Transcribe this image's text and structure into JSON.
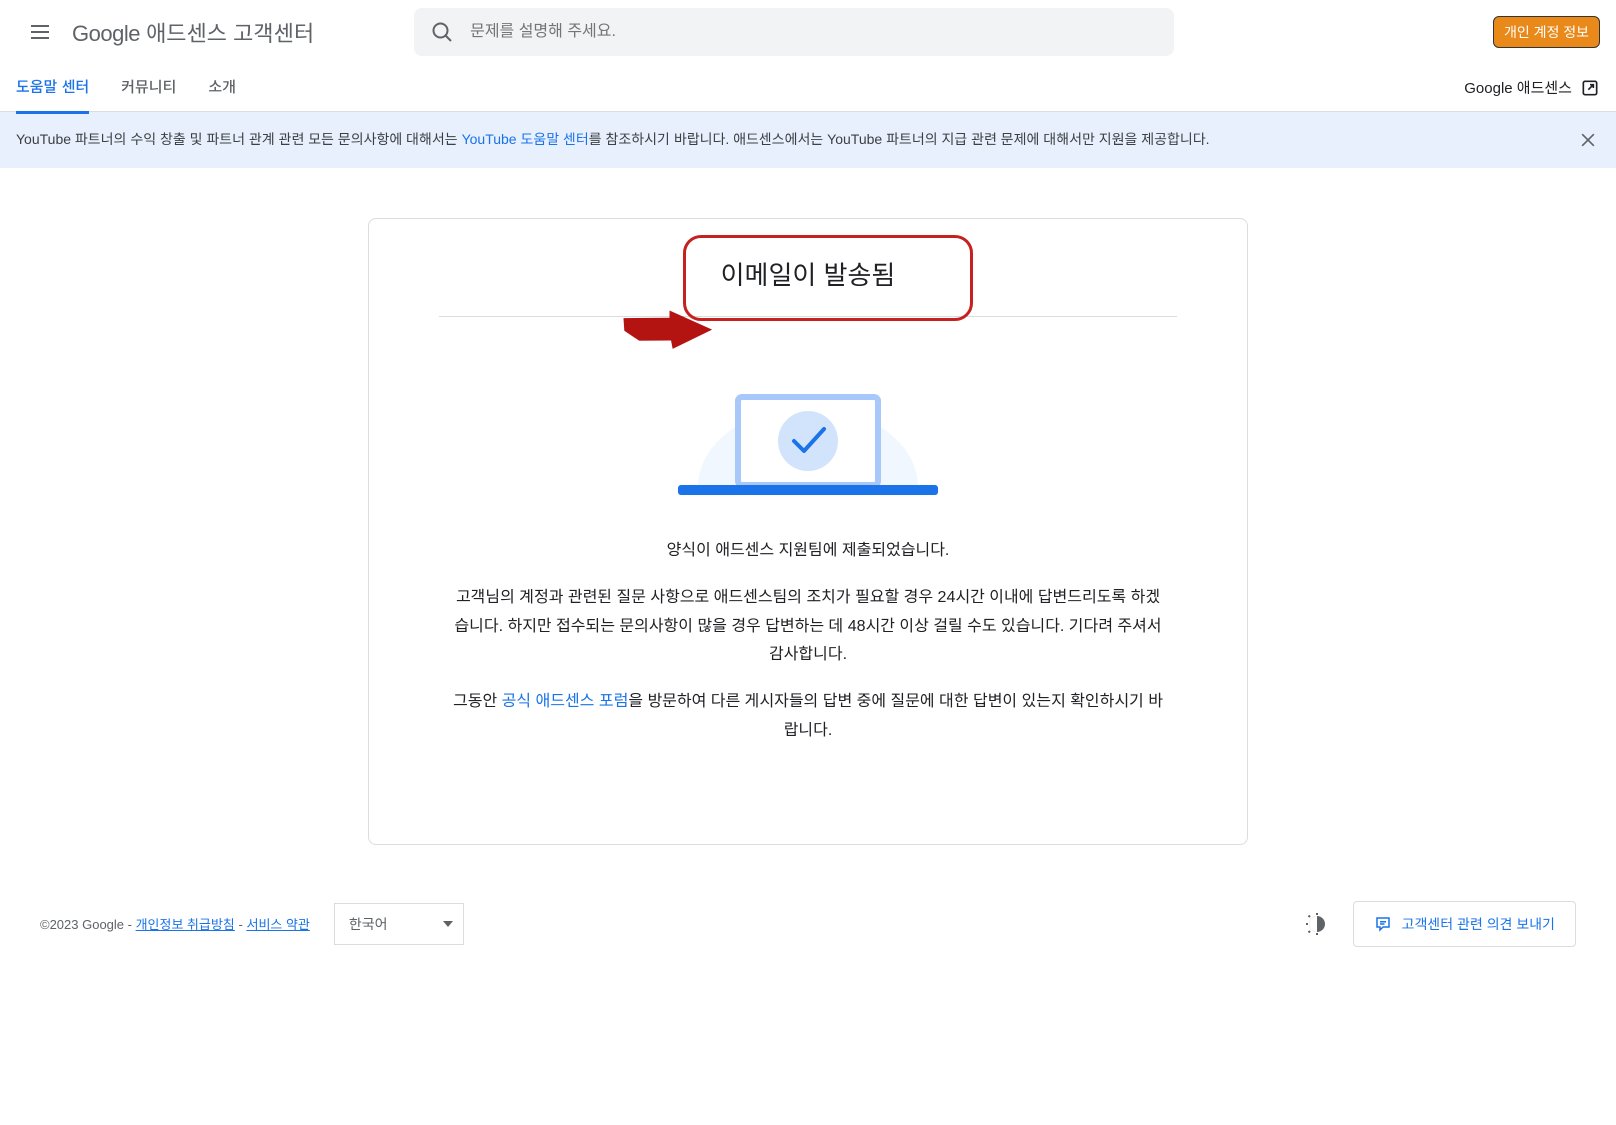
{
  "header": {
    "logo_google": "Google",
    "logo_product": " 애드센스 고객센터",
    "search_placeholder": "문제를 설명해 주세요.",
    "account_badge": "개인 계정 정보"
  },
  "tabs": {
    "help": "도움말 센터",
    "community": "커뮤니티",
    "about": "소개"
  },
  "header_link": {
    "label": "Google 애드센스"
  },
  "notification": {
    "text_before": "YouTube 파트너의 수익 창출 및 파트너 관계 관련 모든 문의사항에 대해서는 ",
    "link_text": "YouTube 도움말 센터",
    "text_after": "를 참조하시기 바랍니다. 애드센스에서는 YouTube 파트너의 지급 관련 문제에 대해서만 지원을 제공합니다."
  },
  "card": {
    "title": "이메일이 발송됨",
    "submitted": "양식이 애드센스 지원팀에 제출되었습니다.",
    "body1": "고객님의 계정과 관련된 질문 사항으로 애드센스팀의 조치가 필요할 경우 24시간 이내에 답변드리도록 하겠습니다. 하지만 접수되는 문의사항이 많을 경우 답변하는 데 48시간 이상 걸릴 수도 있습니다. 기다려 주셔서 감사합니다.",
    "body2_before": "그동안 ",
    "body2_link": "공식 애드센스 포럼",
    "body2_after": "을 방문하여 다른 게시자들의 답변 중에 질문에 대한 답변이 있는지 확인하시기 바랍니다."
  },
  "footer": {
    "copyright": "©2023 Google - ",
    "privacy": "개인정보 취급방침",
    "separator": " - ",
    "terms": "서비스 약관",
    "language": "한국어",
    "feedback": "고객센터 관련 의견 보내기"
  }
}
